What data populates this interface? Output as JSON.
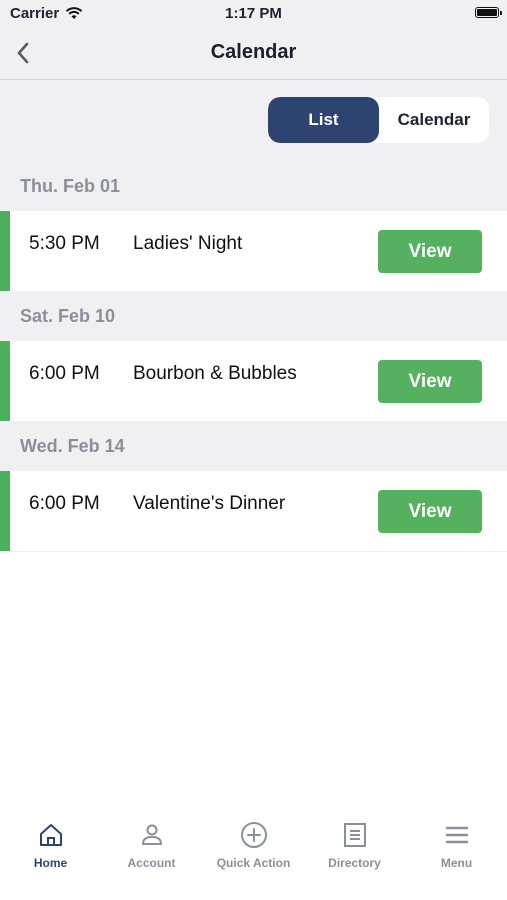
{
  "status_bar": {
    "carrier": "Carrier",
    "time": "1:17 PM"
  },
  "nav": {
    "title": "Calendar"
  },
  "segmented": {
    "list_label": "List",
    "calendar_label": "Calendar",
    "selected": "List"
  },
  "sections": [
    {
      "date": "Thu. Feb 01",
      "events": [
        {
          "time": "5:30 PM",
          "name": "Ladies' Night",
          "button": "View"
        }
      ]
    },
    {
      "date": "Sat. Feb 10",
      "events": [
        {
          "time": "6:00 PM",
          "name": "Bourbon & Bubbles",
          "button": "View"
        }
      ]
    },
    {
      "date": "Wed. Feb 14",
      "events": [
        {
          "time": "6:00 PM",
          "name": "Valentine's Dinner",
          "button": "View"
        }
      ]
    }
  ],
  "tabs": [
    {
      "label": "Home",
      "icon": "home-icon",
      "active": true
    },
    {
      "label": "Account",
      "icon": "account-icon",
      "active": false
    },
    {
      "label": "Quick Action",
      "icon": "plus-circle-icon",
      "active": false
    },
    {
      "label": "Directory",
      "icon": "directory-icon",
      "active": false
    },
    {
      "label": "Menu",
      "icon": "menu-icon",
      "active": false
    }
  ],
  "colors": {
    "accent_green": "#4caf5e",
    "button_green": "#55b060",
    "selected_navy": "#2e4470",
    "muted_gray": "#8c8f99"
  }
}
